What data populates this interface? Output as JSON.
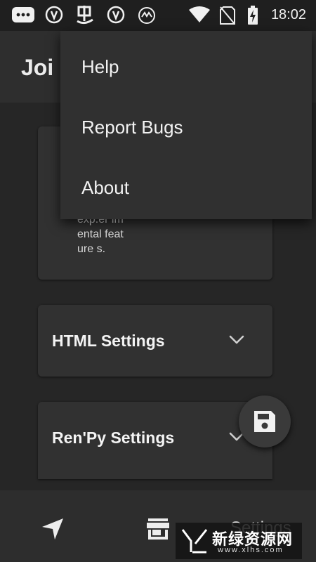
{
  "status_bar": {
    "time": "18:02",
    "icons": [
      "chat-bubble-icon",
      "v-shield-icon",
      "bug-app-icon",
      "v-shield-icon",
      "3m-app-icon",
      "wifi-icon",
      "no-sim-icon",
      "battery-charging-icon"
    ]
  },
  "app_bar": {
    "title": "Joi"
  },
  "overflow_menu": {
    "items": [
      {
        "label": "Help"
      },
      {
        "label": "Report Bugs"
      },
      {
        "label": "About"
      }
    ]
  },
  "cards": {
    "description": {
      "text": "exp.er imental feature s."
    },
    "html_settings": {
      "label": "HTML Settings",
      "icon": "chevron-down-icon"
    },
    "renpy_settings": {
      "label": "Ren'Py Settings",
      "icon": "chevron-down-icon"
    }
  },
  "fab": {
    "icon": "save-icon"
  },
  "bottom_nav": {
    "items": [
      {
        "icon": "navigation-icon"
      },
      {
        "icon": "store-icon"
      },
      {
        "label": "Settings"
      }
    ]
  },
  "watermark": {
    "name": "新绿资源网",
    "url": "www.xlhs.com"
  },
  "colors": {
    "background": "#262626",
    "surface": "#313131",
    "menu": "#303030",
    "text": "#f2f2f2"
  }
}
